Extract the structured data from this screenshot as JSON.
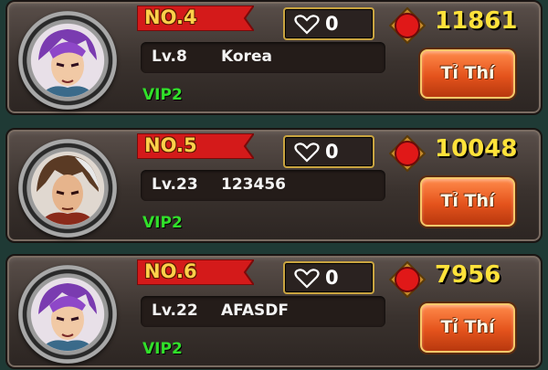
{
  "players": [
    {
      "rank": "NO.4",
      "likes": "0",
      "power": "11861",
      "level": "Lv.8",
      "name": "Korea",
      "vip": "VIP2",
      "button": "Tỉ Thí"
    },
    {
      "rank": "NO.5",
      "likes": "0",
      "power": "10048",
      "level": "Lv.23",
      "name": "123456",
      "vip": "VIP2",
      "button": "Tỉ Thí"
    },
    {
      "rank": "NO.6",
      "likes": "0",
      "power": "7956",
      "level": "Lv.22",
      "name": "AFASDF",
      "vip": "VIP2",
      "button": "Tỉ Thí"
    }
  ],
  "icons": {
    "like": "heart-icon",
    "power": "power-gem-icon",
    "rank": "red-ribbon"
  },
  "colors": {
    "power_text": "#ffe23a",
    "vip_text": "#31e02a",
    "rank_text": "#ffd04a",
    "button": "#e4531c"
  }
}
